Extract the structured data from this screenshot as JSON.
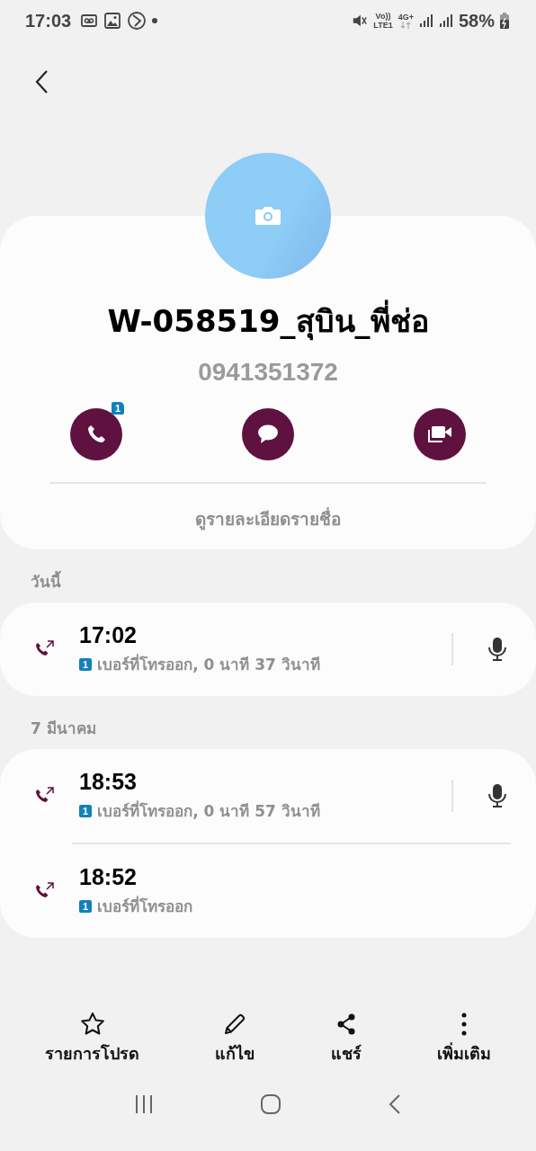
{
  "status_bar": {
    "time": "17:03",
    "network": [
      "Vo))",
      "LTE1"
    ],
    "data": "4G+",
    "battery": "58%"
  },
  "contact": {
    "name": "W-058519_สุบิน_พี่ช่อ",
    "phone": "0941351372",
    "actions": [
      {
        "kind": "call",
        "badge": "1"
      },
      {
        "kind": "message"
      },
      {
        "kind": "video"
      }
    ],
    "details_link": "ดูรายละเอียดรายชื่อ"
  },
  "call_groups": [
    {
      "date": "วันนี้",
      "calls": [
        {
          "time": "17:02",
          "sim": "1",
          "description": "เบอร์ที่โทรออก, 0 นาที 37 วินาที",
          "recording": true
        }
      ]
    },
    {
      "date": "7 มีนาคม",
      "calls": [
        {
          "time": "18:53",
          "sim": "1",
          "description": "เบอร์ที่โทรออก, 0 นาที 57 วินาที",
          "recording": true
        },
        {
          "time": "18:52",
          "sim": "1",
          "description": "เบอร์ที่โทรออก",
          "recording": false
        }
      ]
    }
  ],
  "bottom_actions": [
    {
      "kind": "favorite",
      "label": "รายการโปรด"
    },
    {
      "kind": "edit",
      "label": "แก้ไข"
    },
    {
      "kind": "share",
      "label": "แชร์"
    },
    {
      "kind": "more",
      "label": "เพิ่มเติม"
    }
  ]
}
